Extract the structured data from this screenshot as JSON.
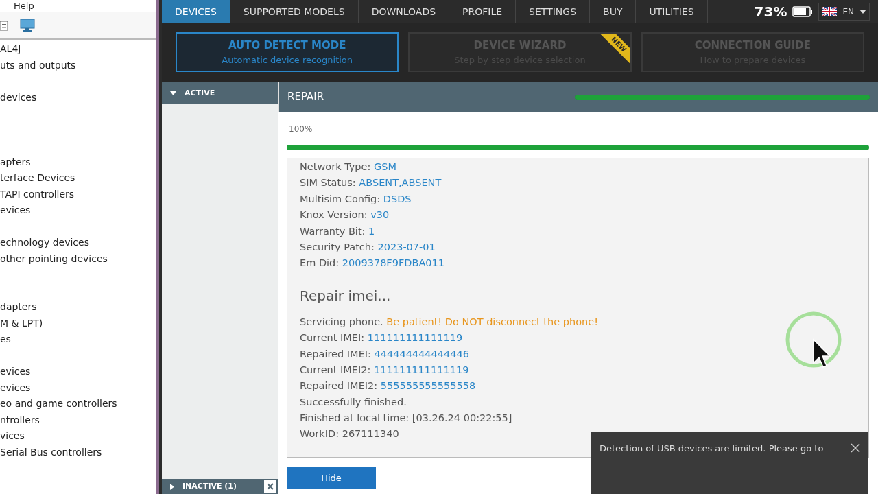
{
  "device_manager": {
    "menu": [
      "Help"
    ],
    "tree": [
      {
        "kind": "item",
        "label": "AL4J"
      },
      {
        "kind": "item",
        "label": "uts and outputs"
      },
      {
        "kind": "blank"
      },
      {
        "kind": "item",
        "label": "devices"
      },
      {
        "kind": "blank"
      },
      {
        "kind": "blank"
      },
      {
        "kind": "blank"
      },
      {
        "kind": "item",
        "label": "apters"
      },
      {
        "kind": "item",
        "label": "terface Devices"
      },
      {
        "kind": "item",
        "label": "TAPI controllers"
      },
      {
        "kind": "item",
        "label": "evices"
      },
      {
        "kind": "blank"
      },
      {
        "kind": "item",
        "label": "echnology devices"
      },
      {
        "kind": "item",
        "label": "other pointing devices"
      },
      {
        "kind": "blank"
      },
      {
        "kind": "blank"
      },
      {
        "kind": "item",
        "label": "dapters"
      },
      {
        "kind": "item",
        "label": "M & LPT)"
      },
      {
        "kind": "item",
        "label": "es"
      },
      {
        "kind": "blank"
      },
      {
        "kind": "item",
        "label": "evices"
      },
      {
        "kind": "item",
        "label": "evices"
      },
      {
        "kind": "item",
        "label": "eo and game controllers"
      },
      {
        "kind": "item",
        "label": "ntrollers"
      },
      {
        "kind": "item",
        "label": "vices"
      },
      {
        "kind": "item",
        "label": "Serial Bus controllers"
      }
    ]
  },
  "tabs": [
    {
      "label": "DEVICES",
      "selected": true
    },
    {
      "label": "SUPPORTED MODELS",
      "selected": false
    },
    {
      "label": "DOWNLOADS",
      "selected": false
    },
    {
      "label": "PROFILE",
      "selected": false
    },
    {
      "label": "SETTINGS",
      "selected": false
    },
    {
      "label": "BUY",
      "selected": false
    },
    {
      "label": "UTILITIES",
      "selected": false
    }
  ],
  "status": {
    "battery": "73%",
    "language": "EN"
  },
  "modes": [
    {
      "title": "AUTO DETECT MODE",
      "subtitle": "Automatic device recognition",
      "selected": true
    },
    {
      "title": "DEVICE WIZARD",
      "subtitle": "Step by step device selection",
      "selected": false,
      "badge": "NEW"
    },
    {
      "title": "CONNECTION GUIDE",
      "subtitle": "How to prepare devices",
      "selected": false
    }
  ],
  "sidebar": {
    "active": {
      "label": "ACTIVE",
      "expanded": true
    },
    "inactive": {
      "label": "INACTIVE (1)",
      "expanded": false
    }
  },
  "repair": {
    "title": "REPAIR",
    "header_progress": {
      "level": 1
    },
    "percent": "100%",
    "level": 1,
    "log": [
      {
        "kind": "info",
        "label": "Network Type:",
        "value": "GSM"
      },
      {
        "kind": "info",
        "label": "SIM Status:",
        "value": "ABSENT,ABSENT"
      },
      {
        "kind": "info",
        "label": "Multisim Config:",
        "value": "DSDS"
      },
      {
        "kind": "info",
        "label": "Knox Version:",
        "value": "v30"
      },
      {
        "kind": "info",
        "label": "Warranty Bit:",
        "value": "1"
      },
      {
        "kind": "info",
        "label": "Security Patch:",
        "value": "2023-07-01"
      },
      {
        "kind": "info",
        "label": "Em Did:",
        "value": "2009378F9FDBA011"
      },
      {
        "kind": "heading",
        "label": "Repair imei..."
      },
      {
        "kind": "warning",
        "label": "Servicing phone.",
        "value": "Be patient! Do NOT disconnect the phone!"
      },
      {
        "kind": "info",
        "label": "Current IMEI:",
        "value": "111111111111119"
      },
      {
        "kind": "info",
        "label": "Repaired IMEI:",
        "value": "444444444444446"
      },
      {
        "kind": "info",
        "label": "Current IMEI2:",
        "value": "111111111111119"
      },
      {
        "kind": "info",
        "label": "Repaired IMEI2:",
        "value": "555555555555558"
      },
      {
        "kind": "text",
        "label": "Successfully finished."
      },
      {
        "kind": "text",
        "label": "Finished at local time: [03.26.24 00:22:55]"
      },
      {
        "kind": "text",
        "label": "WorkID: 267111340"
      }
    ],
    "button": "Hide"
  },
  "toast": {
    "text": "Detection of USB devices are limited. Please go to"
  }
}
